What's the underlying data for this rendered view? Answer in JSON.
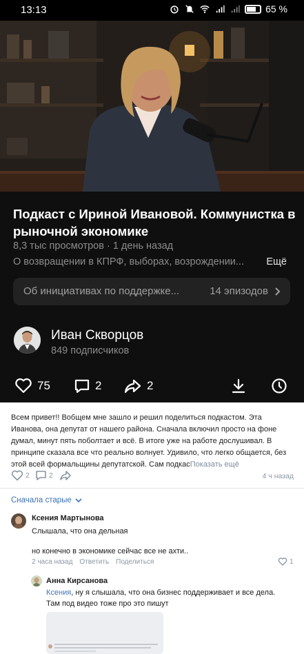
{
  "status_bar": {
    "time": "13:13",
    "battery": "65 %"
  },
  "video": {
    "title": "Подкаст с Ириной Ивановой. Коммунистка в рыночной экономике",
    "views": "8,3 тыс просмотров",
    "separator": " · ",
    "age": "1 день назад",
    "description": "О возвращении в КПРФ, выборах, возрождении...",
    "more_label": "Ещё",
    "playlist": {
      "title": "Об инициативах по поддержке...",
      "count": "14 эпизодов"
    }
  },
  "author": {
    "name": "Иван Скворцов",
    "subscribers": "849 подписчиков"
  },
  "actions": {
    "likes": "75",
    "comments": "2",
    "shares": "2"
  },
  "post": {
    "text": "Всем привет!! Вобщем мне зашло и решил поделиться подкастом. Эта Иванова, она депутат от нашего района. Сначала включил просто на фоне думал, минут пять поболтает и всё. В итоге уже на работе дослушивал. В принципе сказала все что реально волнует. Удивило, что легко общается, без этой всей формальщины депутатской. Сам подкас",
    "show_more": "Показать ещё",
    "likes": "2",
    "comments": "2",
    "time": "4 ч назад"
  },
  "sort_label": "Сначала старые",
  "comments": [
    {
      "author": "Ксения Мартынова",
      "line1": "Слышала, что она дельная",
      "line2": "но конечно в экономике сейчас все не ахти..",
      "time": "2 часа назад",
      "reply": "Ответить",
      "share": "Поделиться",
      "likes": "1"
    },
    {
      "author": "Анна Кирсанова",
      "mention": "Ксения",
      "line1_rest": ", ну я слышала, что она бизнес поддерживает и все дела.",
      "line2": "Там под видео тоже про это пишут"
    }
  ],
  "colors": {
    "accent_link": "#3d73b6",
    "muted_text": "#8a96a4",
    "dark_bg": "#0f0f0f",
    "playlist_bg": "#222222"
  },
  "icons": [
    "heart-icon",
    "comment-icon",
    "share-icon",
    "download-icon",
    "clock-icon",
    "chevron-right-icon",
    "chevron-down-icon"
  ]
}
